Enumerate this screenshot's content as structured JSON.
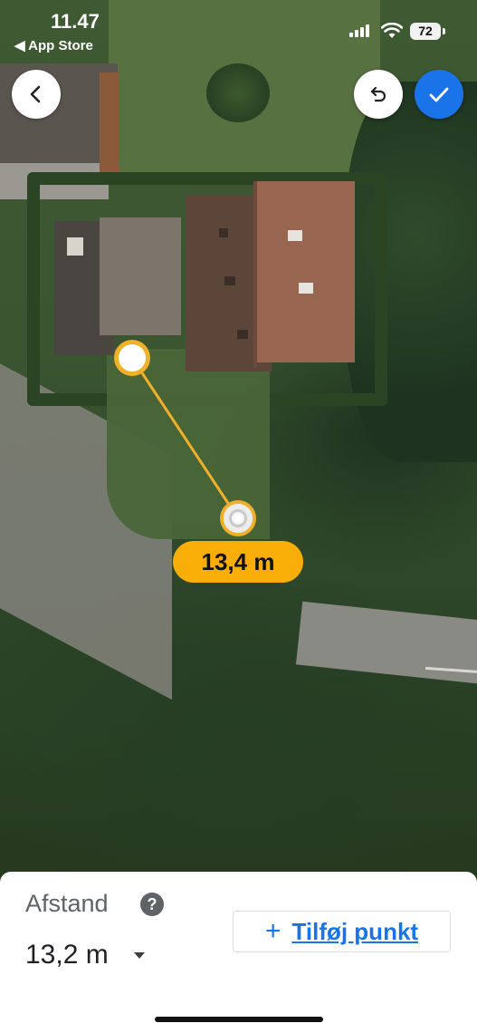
{
  "status_bar": {
    "time": "11.47",
    "back_app": "◀ App Store",
    "battery": "72"
  },
  "map": {
    "measurement_label": "13,4 m",
    "line_color": "#f0b02a"
  },
  "buttons": {
    "back_icon": "chevron-left-icon",
    "undo_icon": "undo-icon",
    "done_icon": "checkmark-icon",
    "done_color": "#1a73e8"
  },
  "sheet": {
    "label": "Afstand",
    "help_glyph": "?",
    "value": "13,2 m",
    "add_point_plus": "+",
    "add_point_label": "Tilføj punkt"
  }
}
